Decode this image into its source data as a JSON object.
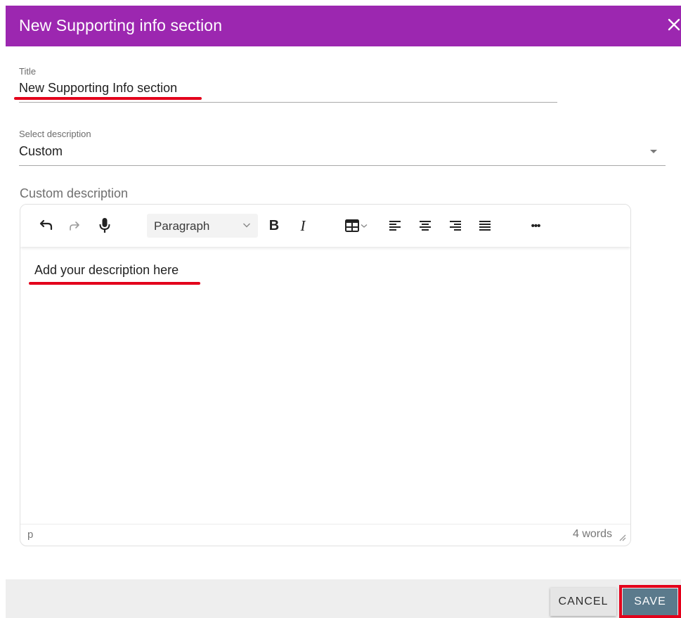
{
  "dialog": {
    "title": "New Supporting info section",
    "close_icon": "close-icon"
  },
  "title_field": {
    "label": "Title",
    "value": "New Supporting Info section"
  },
  "description_select": {
    "label": "Select description",
    "value": "Custom"
  },
  "custom_description": {
    "label": "Custom description"
  },
  "editor": {
    "toolbar": {
      "undo_icon": "undo-icon",
      "redo_icon": "redo-icon",
      "mic_icon": "microphone-icon",
      "block_format": "Paragraph",
      "bold": "B",
      "italic": "I",
      "table_icon": "table-icon",
      "align_left_icon": "align-left-icon",
      "align_center_icon": "align-center-icon",
      "align_right_icon": "align-right-icon",
      "justify_icon": "align-justify-icon",
      "more": "•••"
    },
    "content": "Add your description here",
    "status": {
      "path": "p",
      "word_count": "4 words"
    }
  },
  "footer": {
    "cancel_label": "CANCEL",
    "save_label": "SAVE"
  },
  "colors": {
    "header": "#9c27b0",
    "save_button": "#5b7a8c",
    "highlight": "#e3001b"
  }
}
